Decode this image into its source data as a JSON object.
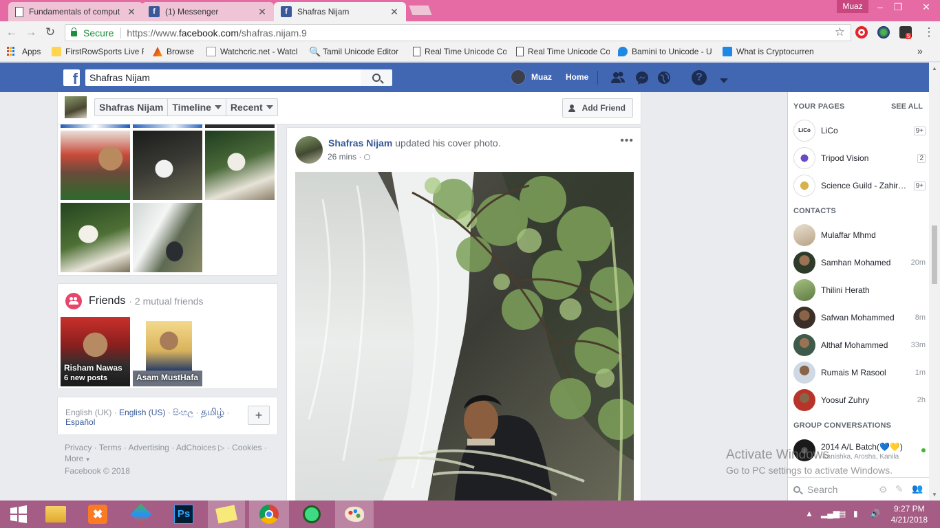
{
  "browser": {
    "tabs": [
      {
        "title": "Fundamentals of comput",
        "icon": "document-icon"
      },
      {
        "title": "(1) Messenger",
        "icon": "facebook-icon"
      },
      {
        "title": "Shafras Nijam",
        "icon": "facebook-icon"
      }
    ],
    "profile_name": "Muaz",
    "secure_label": "Secure",
    "url_scheme": "https://www.",
    "url_host": "facebook.com",
    "url_path": "/shafras.nijam.9",
    "extension_badge": "5",
    "bookmarks": [
      {
        "label": "Apps"
      },
      {
        "label": "FirstRowSports Live F"
      },
      {
        "label": "Browse"
      },
      {
        "label": "Watchcric.net - Watcl"
      },
      {
        "label": "Tamil Unicode Editor"
      },
      {
        "label": "Real Time Unicode Co"
      },
      {
        "label": "Real Time Unicode Co"
      },
      {
        "label": "Bamini to Unicode - U"
      },
      {
        "label": "What is Cryptocurren"
      }
    ],
    "more_bookmarks": "»"
  },
  "facebook": {
    "logo_letter": "f",
    "search_value": "Shafras Nijam",
    "user_name": "Muaz",
    "home_label": "Home",
    "help_label": "?"
  },
  "profile_nav": {
    "name": "Shafras Nijam",
    "timeline": "Timeline",
    "recent": "Recent",
    "add_friend": "Add Friend"
  },
  "friends": {
    "title": "Friends",
    "subtitle": "· 2 mutual friends",
    "items": [
      {
        "name": "Risham Nawas",
        "note": "6 new posts"
      },
      {
        "name": "Asam MustHafa",
        "note": ""
      }
    ]
  },
  "languages": {
    "current": "English (UK)",
    "links": [
      "English (US)",
      "සිංහල",
      "தமிழ்",
      "Español"
    ],
    "add": "+"
  },
  "footer": {
    "links": [
      "Privacy",
      "Terms",
      "Advertising",
      "AdChoices",
      "Cookies"
    ],
    "more": "More",
    "copyright": "Facebook © 2018"
  },
  "post": {
    "author": "Shafras Nijam",
    "action": "updated his cover photo.",
    "time": "26 mins ·",
    "more": "•••"
  },
  "sidebar": {
    "pages_heading": "YOUR PAGES",
    "see_all": "SEE ALL",
    "pages": [
      {
        "name": "LiCo",
        "badge": "9+"
      },
      {
        "name": "Tripod Vision",
        "badge": "2"
      },
      {
        "name": "Science Guild - Zahir…",
        "badge": "9+"
      }
    ],
    "contacts_heading": "CONTACTS",
    "contacts": [
      {
        "name": "Mulaffar Mhmd",
        "time": ""
      },
      {
        "name": "Samhan Mohamed",
        "time": "20m"
      },
      {
        "name": "Thilini Herath",
        "time": ""
      },
      {
        "name": "Safwan Mohammed",
        "time": "8m"
      },
      {
        "name": "Althaf Mohammed",
        "time": "33m"
      },
      {
        "name": "Rumais M Rasool",
        "time": "1m"
      },
      {
        "name": "Yoosuf Zuhry",
        "time": "2h"
      }
    ],
    "groups_heading": "GROUP CONVERSATIONS",
    "group": {
      "name": "2014 A/L Batch(💙💛)",
      "members": "Kanishka, Arosha, Kanila"
    },
    "search_placeholder": "Search"
  },
  "watermark": {
    "line1": "Activate Windows",
    "line2": "Go to PC settings to activate Windows."
  },
  "taskbar": {
    "time": "9:27 PM",
    "date": "4/21/2018"
  },
  "colors": {
    "fb_blue": "#4267b2",
    "link": "#365899",
    "tabstrip": "#e66aa3",
    "taskbar": "#a55c85"
  }
}
